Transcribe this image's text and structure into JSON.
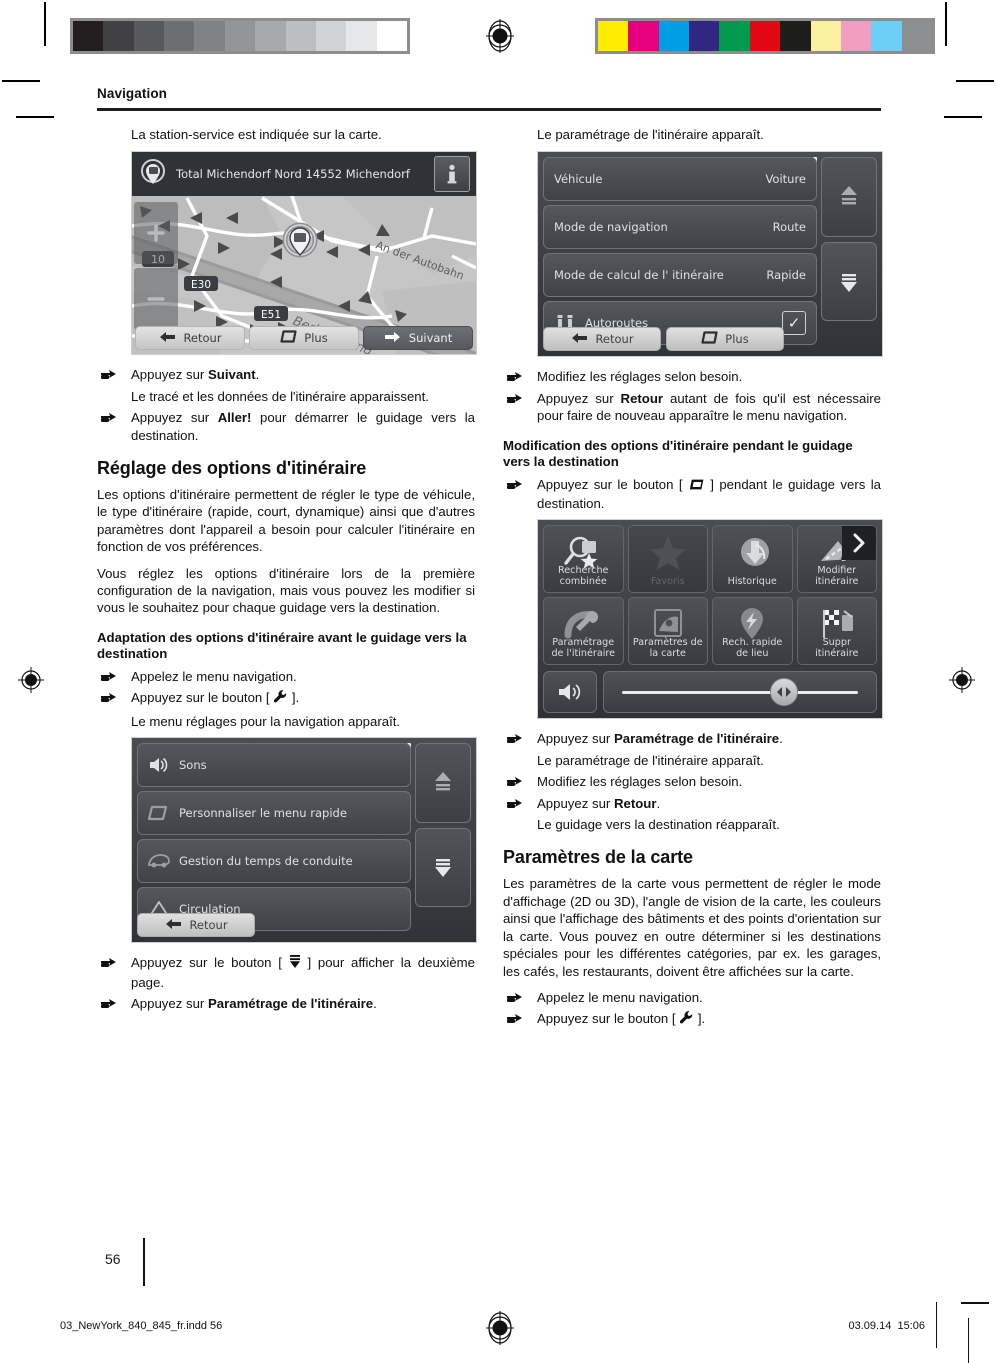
{
  "print_marks": {
    "grayscale_swatches": [
      "#231f20",
      "#414042",
      "#58595b",
      "#6d6e70",
      "#808285",
      "#939598",
      "#a7a9ac",
      "#bcbec0",
      "#d1d3d4",
      "#e6e7e8",
      "#ffffff"
    ],
    "color_swatches": [
      "#ffed00",
      "#e6007e",
      "#009fe3",
      "#312783",
      "#00994d",
      "#e30613",
      "#1d1d1b",
      "#fbf0a0",
      "#f19ec2",
      "#6ecff6",
      "#8e8f91"
    ],
    "registration_icon": "registration-target-icon"
  },
  "header": {
    "running_head": "Navigation"
  },
  "left_column": {
    "intro": "La station-service est indiquée sur la carte.",
    "map_screenshot": {
      "title": "Total Michendorf Nord 14552 Michendorf",
      "info_icon": "info-icon",
      "poi_icon": "fuel-poi-marker-icon",
      "road_labels": [
        "10",
        "E30",
        "E51",
        "An der Autobahn",
        "Berliner Ring"
      ],
      "buttons": [
        {
          "label": "Retour",
          "icon": "arrow-left-icon",
          "style": "light"
        },
        {
          "label": "Plus",
          "icon": "more-icon",
          "style": "light"
        },
        {
          "label": "Suivant",
          "icon": "arrow-right-icon",
          "style": "dark"
        }
      ],
      "zoom_controls": [
        "zoom-in-icon",
        "zoom-out-icon"
      ]
    },
    "steps": [
      {
        "pre": "Appuyez sur ",
        "bold": "Suivant",
        "post": "."
      },
      {
        "note": "Le tracé et les données de l'itinéraire apparaissent."
      },
      {
        "pre": "Appuyez sur ",
        "bold": "Aller!",
        "post": " pour démarrer le guidage vers la destination."
      }
    ],
    "heading_route_options": "Réglage des options d'itinéraire",
    "para1": "Les options d'itinéraire permettent de régler le type de véhicule, le type d'itinéraire (rapide, court, dynamique) ainsi que d'autres paramètres dont l'appareil a besoin pour calculer l'itinéraire en fonction de vos préférences.",
    "para2": "Vous réglez les options d'itinéraire lors de la première configuration de la navigation, mais vous pouvez les modifier si vous le souhaitez pour chaque guidage vers la destination.",
    "subheading_before_guidance": "Adaptation des options d'itinéraire avant le guidage vers la destination",
    "step_call_menu": "Appelez le menu navigation.",
    "step_press_wrench_pre": "Appuyez sur le bouton [ ",
    "step_press_wrench_post": " ].",
    "wrench_icon": "wrench-icon",
    "note_settings_menu": "Le menu réglages pour la navigation apparaît.",
    "settings_screenshot": {
      "rows": [
        {
          "label": "Sons",
          "icon": "speaker-icon"
        },
        {
          "label": "Personnaliser le menu rapide",
          "icon": "quickmenu-icon"
        },
        {
          "label": "Gestion du temps de conduite",
          "icon": "driving-time-icon"
        },
        {
          "label": "Circulation",
          "icon": "traffic-warning-icon"
        }
      ],
      "scroll_up_icon": "scroll-up-icon",
      "scroll_down_icon": "scroll-down-icon",
      "buttons": [
        {
          "label": "Retour",
          "icon": "arrow-left-icon"
        }
      ]
    },
    "step_second_page_pre": "Appuyez sur le bouton [ ",
    "step_second_page_post": " ] pour afficher la deuxième page.",
    "page_down_icon": "page-down-icon",
    "step_route_params_pre": "Appuyez sur ",
    "step_route_params_bold": "Paramétrage de l'itinéraire",
    "step_route_params_post": "."
  },
  "right_column": {
    "intro": "Le paramétrage de l'itinéraire apparaît.",
    "route_params_screenshot": {
      "rows": [
        {
          "label": "Véhicule",
          "value": "Voiture",
          "icon": ""
        },
        {
          "label": "Mode de navigation",
          "value": "Route",
          "icon": ""
        },
        {
          "label": "Mode de calcul de l' itinéraire",
          "value": "Rapide",
          "icon": ""
        },
        {
          "label": "Autoroutes",
          "value": "checked",
          "icon": "motorway-icon"
        }
      ],
      "scroll_up_icon": "scroll-up-icon",
      "scroll_down_icon": "scroll-down-icon",
      "buttons": [
        {
          "label": "Retour",
          "icon": "arrow-left-icon"
        },
        {
          "label": "Plus",
          "icon": "more-icon"
        }
      ]
    },
    "step_modify": "Modifiez les réglages selon besoin.",
    "step_back_pre": "Appuyez sur ",
    "step_back_bold": "Retour",
    "step_back_post": " autant de fois qu'il est nécessaire pour faire de nouveau apparaître le menu navigation.",
    "subheading_during_guidance": "Modification des options d'itinéraire pendant le guidage vers la destination",
    "step_more_button_pre": "Appuyez sur le bouton [ ",
    "step_more_button_post": " ] pendant le guidage vers la destination.",
    "more_icon": "more-icon",
    "quickmenu_screenshot": {
      "cells": [
        {
          "label": "Recherche combinée",
          "icon": "combined-search-icon",
          "dimmed": false
        },
        {
          "label": "Favoris",
          "icon": "star-icon",
          "dimmed": true
        },
        {
          "label": "Historique",
          "icon": "history-icon",
          "dimmed": false
        },
        {
          "label": "Modifier itinéraire",
          "icon": "edit-route-icon",
          "dimmed": false
        },
        {
          "label": "Paramétrage de l'itinéraire",
          "icon": "route-settings-icon",
          "dimmed": false
        },
        {
          "label": "Paramètres de la carte",
          "icon": "map-settings-icon",
          "dimmed": false
        },
        {
          "label": "Rech. rapide de lieu",
          "icon": "quick-place-search-icon",
          "dimmed": false
        },
        {
          "label": "Suppr itinéraire",
          "icon": "delete-route-icon",
          "dimmed": false
        }
      ],
      "next_page_icon": "chevron-right-icon",
      "volume_icon": "speaker-icon",
      "volume_slider_icon": "slider-knob-icon"
    },
    "step_route_params_pre": "Appuyez sur ",
    "step_route_params_bold": "Paramétrage de l'itinéraire",
    "step_route_params_post": ".",
    "note_route_params": "Le paramétrage de l'itinéraire apparaît.",
    "step_modify2": "Modifiez les réglages selon besoin.",
    "step_back2_pre": "Appuyez sur ",
    "step_back2_bold": "Retour",
    "step_back2_post": ".",
    "note_guidance_back": "Le guidage vers la destination réapparaît.",
    "heading_map_params": "Paramètres de la carte",
    "para_map": "Les paramètres de la carte vous permettent de régler le mode d'affichage (2D ou 3D), l'angle de vision de la carte, les couleurs ainsi que l'affichage des bâtiments et des points d'orientation sur la carte. Vous pouvez en outre déterminer si les destinations spéciales pour les différentes catégories, par ex. les garages, les cafés, les restaurants, doivent être affichées sur la carte.",
    "step_call_menu": "Appelez le menu navigation.",
    "step_press_wrench_pre": "Appuyez sur le bouton [ ",
    "step_press_wrench_post": " ].",
    "wrench_icon": "wrench-icon"
  },
  "footer": {
    "folio": "56",
    "slug_file": "03_NewYork_840_845_fr.indd   56",
    "slug_date": "03.09.14",
    "slug_time": "15:06"
  }
}
